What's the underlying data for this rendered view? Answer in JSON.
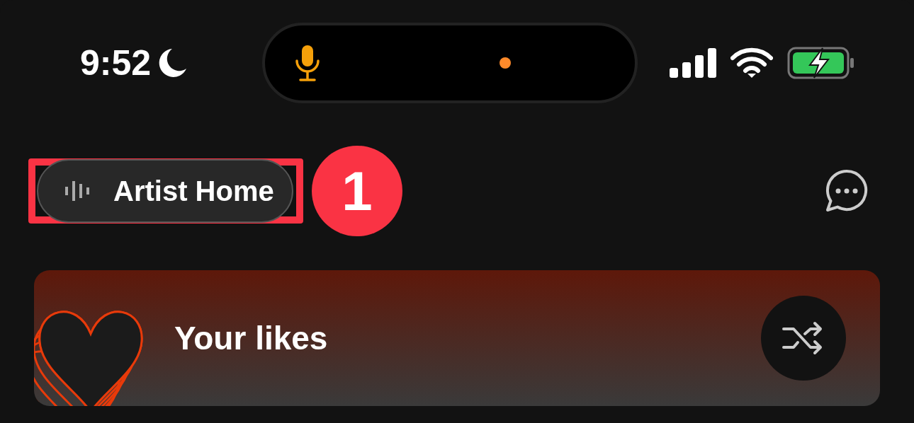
{
  "status_bar": {
    "time": "9:52"
  },
  "header": {
    "artist_home_button": {
      "label": "Artist Home"
    },
    "annotation": {
      "number": "1"
    }
  },
  "likes_card": {
    "title": "Your likes"
  }
}
